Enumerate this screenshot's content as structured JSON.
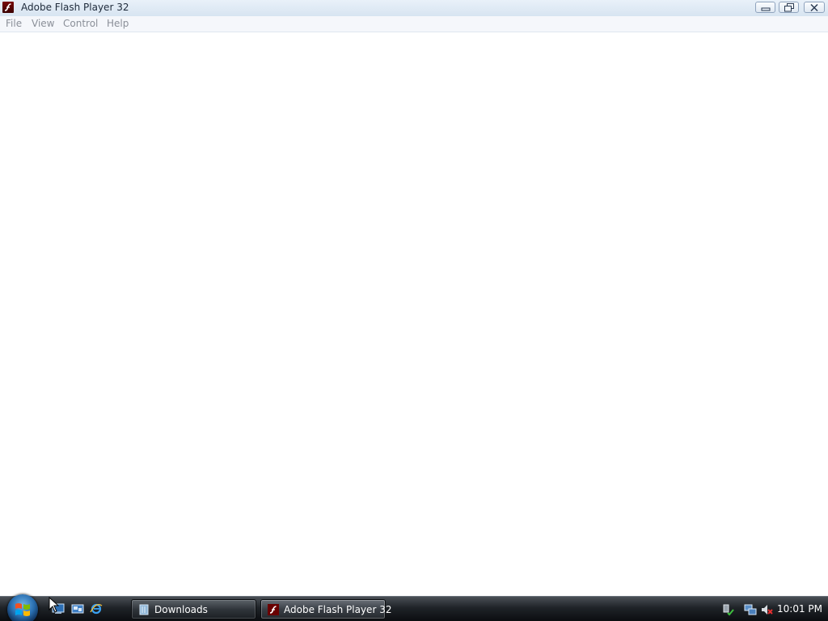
{
  "window": {
    "title": "Adobe Flash Player 32",
    "icon": "flash-player-icon"
  },
  "menu": {
    "items": [
      "File",
      "View",
      "Control",
      "Help"
    ]
  },
  "taskbar": {
    "quick_launch": [
      "show-desktop-icon",
      "switch-windows-icon",
      "internet-explorer-icon"
    ],
    "tasks": [
      {
        "label": "Downloads",
        "icon": "folder-icon"
      },
      {
        "label": "Adobe Flash Player 32",
        "icon": "flash-player-icon"
      }
    ],
    "tray_icons": [
      "safely-remove-hardware-icon",
      "network-icon",
      "volume-muted-icon"
    ],
    "clock": "10:01 PM"
  },
  "colors": {
    "flash_icon": "#5a0000",
    "taskbar": "#1f2328",
    "titlebar": "#dce7f3"
  }
}
